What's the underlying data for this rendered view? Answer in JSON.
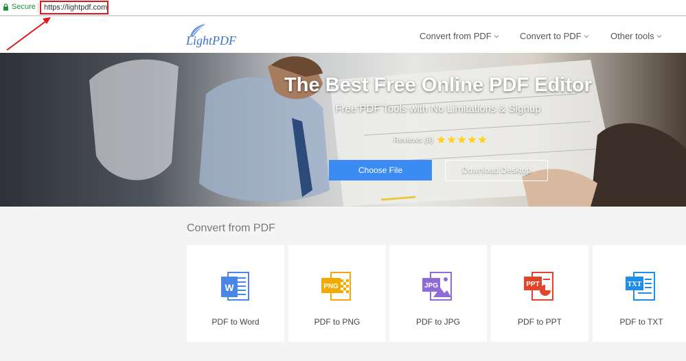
{
  "browser": {
    "secure_label": "Secure",
    "url": "https://lightpdf.com"
  },
  "header": {
    "logo_text": "LightPDF",
    "nav": [
      {
        "label": "Convert from PDF"
      },
      {
        "label": "Convert to PDF"
      },
      {
        "label": "Other tools"
      }
    ]
  },
  "hero": {
    "title": "The Best Free Online PDF Editor",
    "subtitle": "Free PDF Tools with No Limitations & Signup",
    "reviews_label": "Reviews (9)",
    "rating": 5,
    "choose_label": "Choose File",
    "download_label": "Download Desktop"
  },
  "section": {
    "title": "Convert from PDF",
    "cards": [
      {
        "label": "PDF to Word",
        "icon": "word-icon",
        "badge": "W",
        "color": "#4a86e8"
      },
      {
        "label": "PDF to PNG",
        "icon": "png-icon",
        "badge": "PNG",
        "color": "#f2a900"
      },
      {
        "label": "PDF to JPG",
        "icon": "jpg-icon",
        "badge": "JPG",
        "color": "#8e6bd8"
      },
      {
        "label": "PDF to PPT",
        "icon": "ppt-icon",
        "badge": "PPT",
        "color": "#e0442a"
      },
      {
        "label": "PDF to TXT",
        "icon": "txt-icon",
        "badge": "TXT",
        "color": "#1e8ee8"
      }
    ]
  },
  "colors": {
    "accent": "#3b8cf2",
    "annotation": "#e0141b"
  }
}
